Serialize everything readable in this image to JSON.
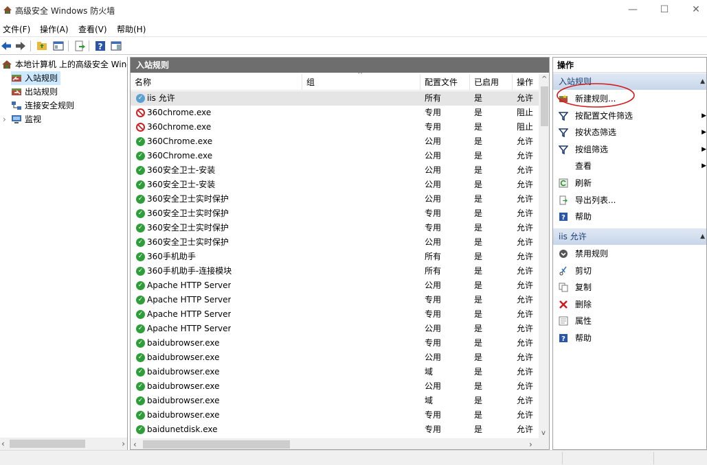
{
  "window": {
    "title": "高级安全 Windows 防火墙",
    "minimize": "—",
    "maximize": "☐",
    "close": "✕"
  },
  "menu": [
    "文件(F)",
    "操作(A)",
    "查看(V)",
    "帮助(H)"
  ],
  "tree": {
    "root": "本地计算机 上的高级安全 Windows",
    "items": [
      "入站规则",
      "出站规则",
      "连接安全规则",
      "监视"
    ]
  },
  "center": {
    "title": "入站规则",
    "columns": [
      "名称",
      "组",
      "配置文件",
      "已启用",
      "操作"
    ],
    "rows": [
      {
        "name": "iis 允许",
        "group": "",
        "profile": "所有",
        "enabled": "是",
        "action": "允许",
        "icon": "allow-icon"
      },
      {
        "name": "360chrome.exe",
        "group": "",
        "profile": "专用",
        "enabled": "是",
        "action": "阻止",
        "icon": "block-icon"
      },
      {
        "name": "360chrome.exe",
        "group": "",
        "profile": "专用",
        "enabled": "是",
        "action": "阻止",
        "icon": "block-icon"
      },
      {
        "name": "360Chrome.exe",
        "group": "",
        "profile": "公用",
        "enabled": "是",
        "action": "允许",
        "icon": "allow-icon"
      },
      {
        "name": "360Chrome.exe",
        "group": "",
        "profile": "公用",
        "enabled": "是",
        "action": "允许",
        "icon": "allow-icon"
      },
      {
        "name": "360安全卫士-安装",
        "group": "",
        "profile": "公用",
        "enabled": "是",
        "action": "允许",
        "icon": "allow-icon"
      },
      {
        "name": "360安全卫士-安装",
        "group": "",
        "profile": "公用",
        "enabled": "是",
        "action": "允许",
        "icon": "allow-icon"
      },
      {
        "name": "360安全卫士实时保护",
        "group": "",
        "profile": "公用",
        "enabled": "是",
        "action": "允许",
        "icon": "allow-icon"
      },
      {
        "name": "360安全卫士实时保护",
        "group": "",
        "profile": "专用",
        "enabled": "是",
        "action": "允许",
        "icon": "allow-icon"
      },
      {
        "name": "360安全卫士实时保护",
        "group": "",
        "profile": "专用",
        "enabled": "是",
        "action": "允许",
        "icon": "allow-icon"
      },
      {
        "name": "360安全卫士实时保护",
        "group": "",
        "profile": "公用",
        "enabled": "是",
        "action": "允许",
        "icon": "allow-icon"
      },
      {
        "name": "360手机助手",
        "group": "",
        "profile": "所有",
        "enabled": "是",
        "action": "允许",
        "icon": "allow-icon"
      },
      {
        "name": "360手机助手-连接模块",
        "group": "",
        "profile": "所有",
        "enabled": "是",
        "action": "允许",
        "icon": "allow-icon"
      },
      {
        "name": "Apache HTTP Server",
        "group": "",
        "profile": "公用",
        "enabled": "是",
        "action": "允许",
        "icon": "allow-icon"
      },
      {
        "name": "Apache HTTP Server",
        "group": "",
        "profile": "专用",
        "enabled": "是",
        "action": "允许",
        "icon": "allow-icon"
      },
      {
        "name": "Apache HTTP Server",
        "group": "",
        "profile": "专用",
        "enabled": "是",
        "action": "允许",
        "icon": "allow-icon"
      },
      {
        "name": "Apache HTTP Server",
        "group": "",
        "profile": "公用",
        "enabled": "是",
        "action": "允许",
        "icon": "allow-icon"
      },
      {
        "name": "baidubrowser.exe",
        "group": "",
        "profile": "专用",
        "enabled": "是",
        "action": "允许",
        "icon": "allow-icon"
      },
      {
        "name": "baidubrowser.exe",
        "group": "",
        "profile": "公用",
        "enabled": "是",
        "action": "允许",
        "icon": "allow-icon"
      },
      {
        "name": "baidubrowser.exe",
        "group": "",
        "profile": "域",
        "enabled": "是",
        "action": "允许",
        "icon": "allow-icon"
      },
      {
        "name": "baidubrowser.exe",
        "group": "",
        "profile": "公用",
        "enabled": "是",
        "action": "允许",
        "icon": "allow-icon"
      },
      {
        "name": "baidubrowser.exe",
        "group": "",
        "profile": "域",
        "enabled": "是",
        "action": "允许",
        "icon": "allow-icon"
      },
      {
        "name": "baidubrowser.exe",
        "group": "",
        "profile": "专用",
        "enabled": "是",
        "action": "允许",
        "icon": "allow-icon"
      },
      {
        "name": "baidunetdisk.exe",
        "group": "",
        "profile": "专用",
        "enabled": "是",
        "action": "允许",
        "icon": "allow-icon"
      }
    ]
  },
  "actions": {
    "title": "操作",
    "section1": "入站规则",
    "section1_items": [
      {
        "label": "新建规则...",
        "icon": "new-rule-icon",
        "submenu": false
      },
      {
        "label": "按配置文件筛选",
        "icon": "filter-icon",
        "submenu": true
      },
      {
        "label": "按状态筛选",
        "icon": "filter-icon",
        "submenu": true
      },
      {
        "label": "按组筛选",
        "icon": "filter-icon",
        "submenu": true
      },
      {
        "label": "查看",
        "icon": "",
        "submenu": true
      },
      {
        "label": "刷新",
        "icon": "refresh-icon",
        "submenu": false
      },
      {
        "label": "导出列表...",
        "icon": "export-icon",
        "submenu": false
      },
      {
        "label": "帮助",
        "icon": "help-icon",
        "submenu": false
      }
    ],
    "section2": "iis 允许",
    "section2_items": [
      {
        "label": "禁用规则",
        "icon": "disable-icon"
      },
      {
        "label": "剪切",
        "icon": "cut-icon"
      },
      {
        "label": "复制",
        "icon": "copy-icon"
      },
      {
        "label": "删除",
        "icon": "delete-icon"
      },
      {
        "label": "属性",
        "icon": "properties-icon"
      },
      {
        "label": "帮助",
        "icon": "help-icon"
      }
    ]
  },
  "colors": {
    "allow": "#2e9e3a",
    "block": "#d02020",
    "header_bar": "#6e6e6e",
    "section_text": "#1a3e72",
    "highlight_ellipse": "#d01c1c"
  }
}
